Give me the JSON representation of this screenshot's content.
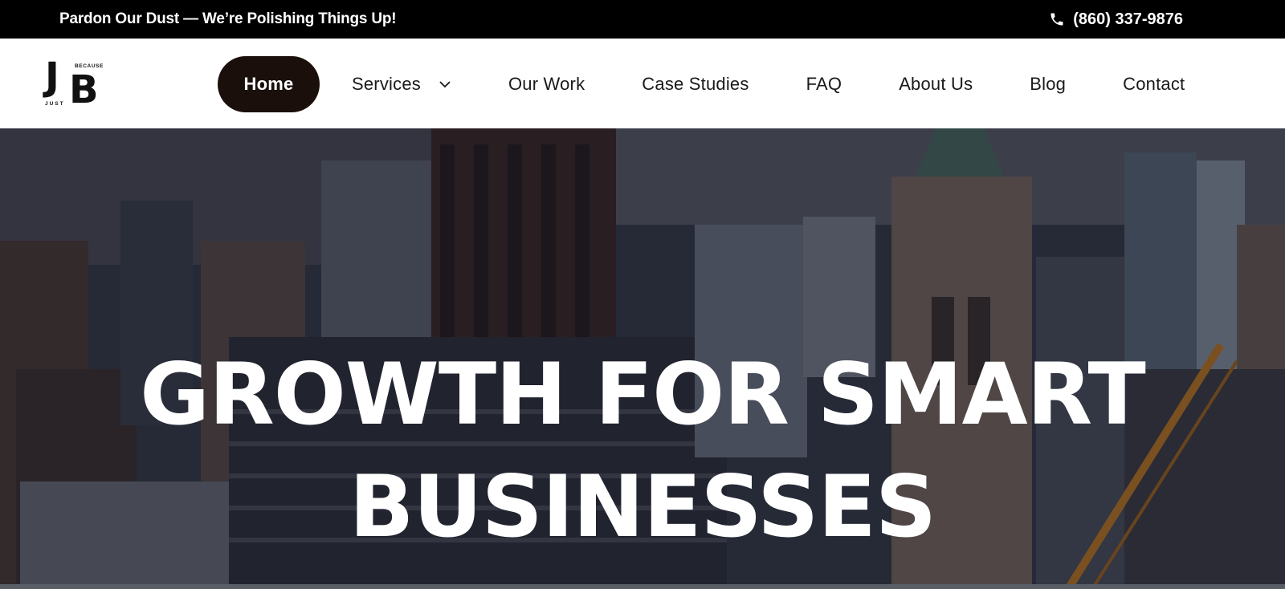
{
  "topbar": {
    "announcement": "Pardon Our Dust — We’re Polishing Things Up!",
    "phone": "(860) 337-9876",
    "phone_icon": "phone-icon"
  },
  "logo": {
    "letter_j": "J",
    "letter_b": "B",
    "word_because": "BECAUSE",
    "word_just": "JUST"
  },
  "nav": {
    "home": "Home",
    "services": "Services",
    "services_icon": "chevron-down-icon",
    "our_work": "Our Work",
    "case_studies": "Case Studies",
    "faq": "FAQ",
    "about_us": "About Us",
    "blog": "Blog",
    "contact": "Contact",
    "active": "Home"
  },
  "hero": {
    "title_line_1": "GROWTH FOR SMART",
    "title_line_2": "BUSINESSES"
  },
  "colors": {
    "topbar_bg": "#000000",
    "header_bg": "#ffffff",
    "active_pill_bg": "#1a0f0a",
    "nav_text": "#1a1a1a",
    "hero_text": "#ffffff"
  }
}
